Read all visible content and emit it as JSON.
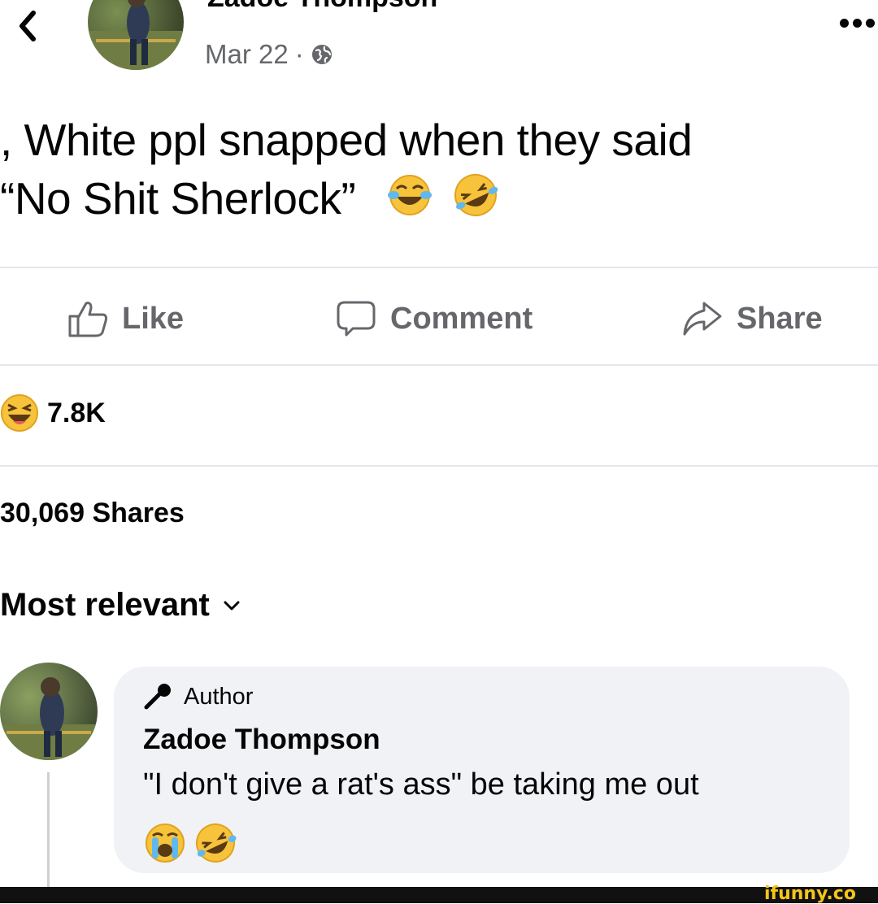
{
  "header": {
    "back_icon": "chevron-left-icon",
    "author_name": "Zadoe Thompson",
    "date": "Mar 22",
    "separator": "·",
    "privacy_icon": "globe-icon",
    "more_icon": "ellipsis-icon"
  },
  "post": {
    "line1": ", White ppl snapped when they said",
    "line2": "“No Shit Sherlock”",
    "emojis": [
      "face-with-tears-of-joy",
      "rolling-on-the-floor-laughing"
    ]
  },
  "actions": {
    "like": "Like",
    "comment": "Comment",
    "share": "Share"
  },
  "stats": {
    "reaction_icon": "laughing-emoji-icon",
    "reaction_count": "7.8K",
    "shares": "30,069 Shares"
  },
  "sort": {
    "label": "Most relevant"
  },
  "comment": {
    "badge": "Author",
    "author": "Zadoe Thompson",
    "text": "\"I don't give a rat's ass\" be taking me out",
    "emojis": [
      "loudly-crying-face",
      "rolling-on-the-floor-laughing"
    ]
  },
  "watermark": "ifunny.co",
  "colors": {
    "text": "#050505",
    "secondary": "#65676b",
    "bubble": "#f0f2f5",
    "divider": "#e4e6eb",
    "emoji_yellow": "#f7c33b",
    "watermark": "#f5c518"
  }
}
